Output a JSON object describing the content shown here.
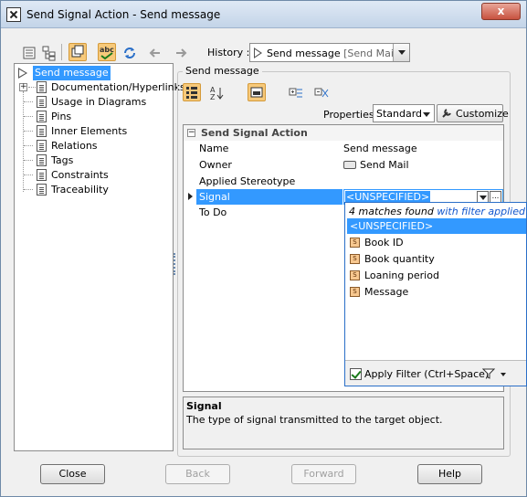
{
  "window": {
    "title": "Send Signal Action - Send message",
    "close_label": "x"
  },
  "toolbar": {
    "history_label": "History :",
    "history_value": "Send message",
    "history_value_extra": "[Send Mail]"
  },
  "tree": {
    "root": "Send message",
    "items": [
      {
        "label": "Documentation/Hyperlinks"
      },
      {
        "label": "Usage in Diagrams"
      },
      {
        "label": "Pins"
      },
      {
        "label": "Inner Elements"
      },
      {
        "label": "Relations"
      },
      {
        "label": "Tags"
      },
      {
        "label": "Constraints"
      },
      {
        "label": "Traceability"
      }
    ]
  },
  "panel": {
    "group_title": "Send message",
    "properties_label": "Properties:",
    "properties_value": "Standard",
    "customize_label": "Customize"
  },
  "grid": {
    "section": "Send Signal Action",
    "rows": [
      {
        "name": "Name",
        "value": "Send message"
      },
      {
        "name": "Owner",
        "value": "Send Mail"
      },
      {
        "name": "Applied Stereotype",
        "value": ""
      },
      {
        "name": "Signal",
        "value": "<UNSPECIFIED>"
      },
      {
        "name": "To Do",
        "value": ""
      }
    ]
  },
  "popup": {
    "status_prefix": "4 matches found ",
    "status_link": "with filter applied",
    "options": [
      {
        "label": "<UNSPECIFIED>",
        "selected": true
      },
      {
        "label": "Book ID"
      },
      {
        "label": "Book quantity"
      },
      {
        "label": "Loaning period"
      },
      {
        "label": "Message"
      }
    ],
    "apply_filter_label": "Apply Filter (Ctrl+Space)"
  },
  "description": {
    "title": "Signal",
    "text": "The type of signal transmitted to the target object."
  },
  "buttons": {
    "close": "Close",
    "back": "Back",
    "forward": "Forward",
    "help": "Help"
  },
  "colors": {
    "selection": "#3399ff",
    "active_toolbar": "#f7c97a",
    "link": "#1155cc"
  }
}
